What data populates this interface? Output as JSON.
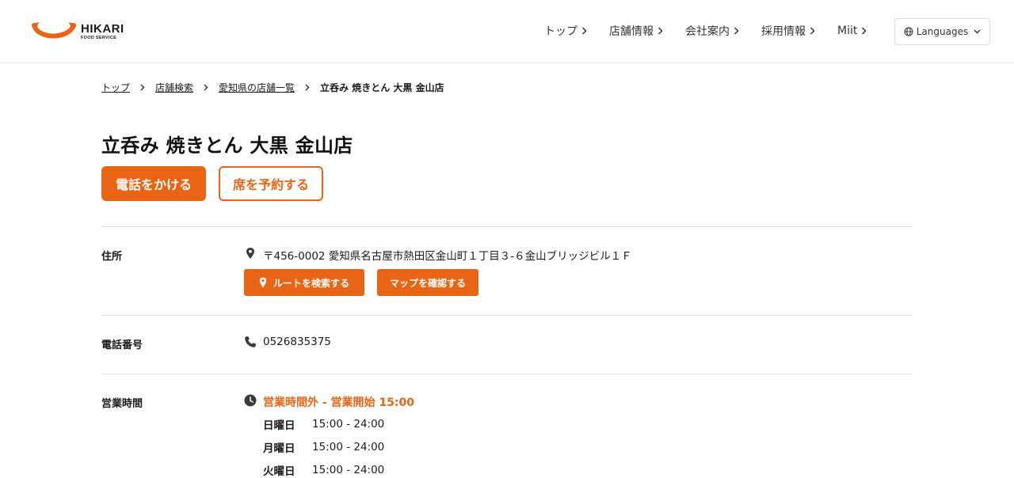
{
  "header": {
    "logo": {
      "name": "HIKARI",
      "sub": "FOOD SERVICE"
    },
    "nav": [
      {
        "label": "トップ"
      },
      {
        "label": "店舗情報"
      },
      {
        "label": "会社案内"
      },
      {
        "label": "採用情報"
      },
      {
        "label": "Miit"
      }
    ],
    "languages_label": "Languages"
  },
  "breadcrumb": {
    "items": [
      "トップ",
      "店舗検索",
      "愛知県の店舗一覧"
    ],
    "current": "立呑み 焼きとん 大黒 金山店"
  },
  "store": {
    "title": "立呑み 焼きとん 大黒 金山店",
    "call_label": "電話をかける",
    "reserve_label": "席を予約する"
  },
  "details": {
    "address": {
      "label": "住所",
      "value": "〒456-0002 愛知県名古屋市熱田区金山町１丁目３-６金山ブリッジビル１Ｆ",
      "route_label": "ルートを検索する",
      "map_label": "マップを確認する"
    },
    "phone": {
      "label": "電話番号",
      "value": "0526835375"
    },
    "hours": {
      "label": "営業時間",
      "status": "営業時間外 - 営業開始 15:00",
      "rows": [
        {
          "day": "日曜日",
          "time": "15:00 - 24:00"
        },
        {
          "day": "月曜日",
          "time": "15:00 - 24:00"
        },
        {
          "day": "火曜日",
          "time": "15:00 - 24:00"
        }
      ]
    }
  },
  "colors": {
    "accent": "#e96515",
    "text": "#1a1a1a",
    "divider": "#e3e3e3"
  },
  "icons": [
    "hikari-smile-logo",
    "chevron-right-icon",
    "globe-icon",
    "chevron-down-icon",
    "map-pin-icon",
    "phone-icon",
    "clock-icon"
  ]
}
